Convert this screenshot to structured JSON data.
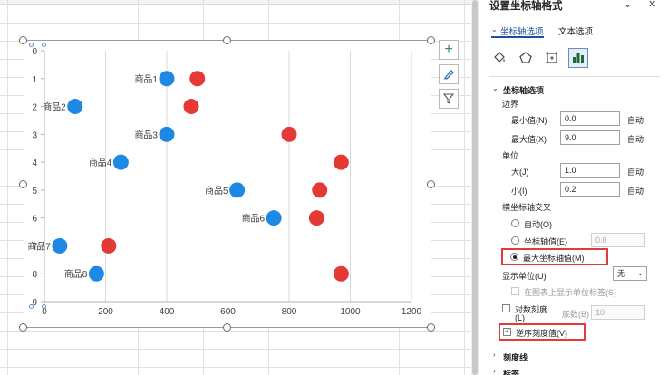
{
  "chart_data": {
    "type": "bar",
    "subtype": "floating-range-horizontal",
    "categories": [
      "商品1",
      "商品2",
      "商品3",
      "商品4",
      "商品5",
      "商品6",
      "商品7",
      "商品8"
    ],
    "series": [
      {
        "start": [
          400,
          100,
          400,
          250,
          630,
          750,
          50,
          170
        ],
        "end": [
          500,
          480,
          800,
          970,
          900,
          890,
          210,
          970
        ]
      }
    ],
    "x_ticks": [
      "0",
      "200",
      "400",
      "600",
      "800",
      "1000",
      "1200"
    ],
    "y_ticks": [
      "0",
      "1",
      "2",
      "3",
      "4",
      "5",
      "6",
      "7",
      "8",
      "9"
    ],
    "xlim": [
      0,
      1200
    ],
    "ylim": [
      0,
      9
    ],
    "y_reversed": true,
    "grid": true,
    "colors": {
      "start": "#1e88e5",
      "end": "#e53935",
      "axis": "#b0b0b0",
      "grid": "#d9d9d9",
      "label": "#404040"
    }
  },
  "pane": {
    "title": "设置坐标轴格式",
    "tabs": [
      "坐标轴选项",
      "文本选项"
    ],
    "section": "坐标轴选项",
    "bounds": {
      "label": "边界",
      "min_label": "最小值(N)",
      "min_value": "0.0",
      "max_label": "最大值(X)",
      "max_value": "9.0",
      "auto": "自动"
    },
    "units": {
      "label": "单位",
      "major_label": "大(J)",
      "major_value": "1.0",
      "minor_label": "小(I)",
      "minor_value": "0.2",
      "auto": "自动"
    },
    "cross": {
      "label": "横坐标轴交叉",
      "opt_auto": "自动(O)",
      "opt_value": "坐标轴值(E)",
      "opt_value_field": "0.0",
      "opt_max": "最大坐标轴值(M)"
    },
    "display_units": {
      "label": "显示单位(U)",
      "value": "无",
      "show_label": "在图表上显示单位标签(S)"
    },
    "log": {
      "label": "对数刻度",
      "label2": "(L)",
      "base_label": "底数(B)",
      "base_value": "10"
    },
    "reverse": {
      "label": "逆序刻度值(V)"
    },
    "more": [
      "刻度线",
      "标签"
    ]
  }
}
